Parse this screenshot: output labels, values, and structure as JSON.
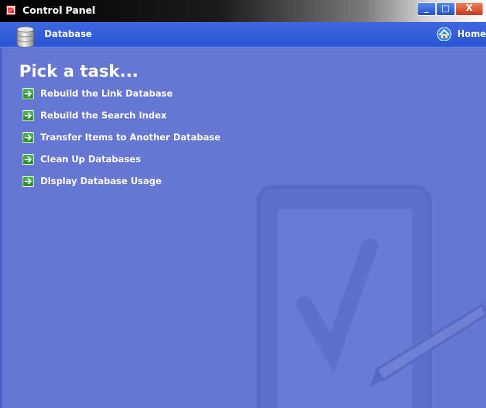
{
  "window": {
    "title": "Control Panel",
    "icon": "control-panel-icon",
    "buttons": {
      "minimize": "_",
      "maximize": "□",
      "close": "X"
    }
  },
  "header": {
    "title": "Database",
    "icon": "database-icon",
    "home_label": "Home",
    "home_icon": "home-icon"
  },
  "main": {
    "heading": "Pick a task...",
    "tasks": [
      {
        "label": "Rebuild the Link Database",
        "icon": "green-arrow-icon"
      },
      {
        "label": "Rebuild the Search Index",
        "icon": "green-arrow-icon"
      },
      {
        "label": "Transfer Items to Another Database",
        "icon": "green-arrow-icon"
      },
      {
        "label": "Clean Up Databases",
        "icon": "green-arrow-icon"
      },
      {
        "label": "Display Database Usage",
        "icon": "green-arrow-icon"
      }
    ]
  },
  "colors": {
    "content_bg": "#6577d3",
    "header_bg": "#2a55d2",
    "accent_green": "#2aa02a"
  }
}
